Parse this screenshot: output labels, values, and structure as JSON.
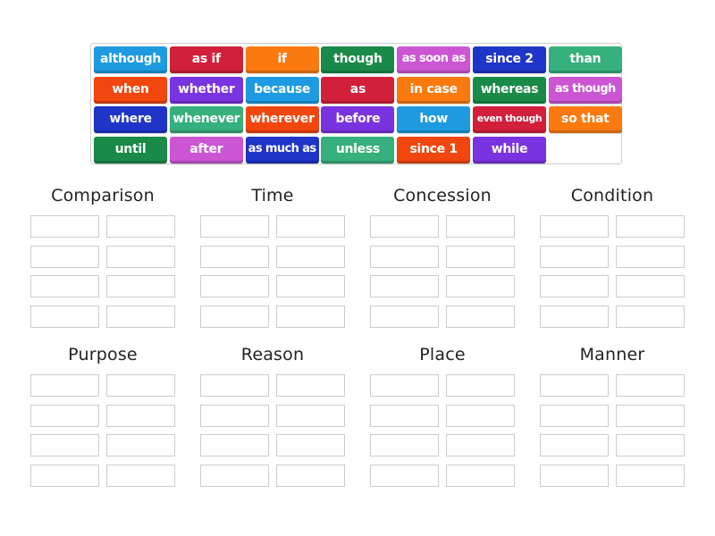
{
  "tile_bank": {
    "tiles": [
      {
        "label": "although",
        "color": "#1e9be0"
      },
      {
        "label": "as if",
        "color": "#d21f3a"
      },
      {
        "label": "if",
        "color": "#fb7a10"
      },
      {
        "label": "though",
        "color": "#198a48"
      },
      {
        "label": "as soon as",
        "color": "#cc55d4"
      },
      {
        "label": "since 2",
        "color": "#1f35c8"
      },
      {
        "label": "than",
        "color": "#36b07c"
      },
      {
        "label": "when",
        "color": "#f2460f"
      },
      {
        "label": "whether",
        "color": "#7a33e0"
      },
      {
        "label": "because",
        "color": "#1e9be0"
      },
      {
        "label": "as",
        "color": "#d21f3a"
      },
      {
        "label": "in case",
        "color": "#fb7a10"
      },
      {
        "label": "whereas",
        "color": "#198a48"
      },
      {
        "label": "as though",
        "color": "#cc55d4"
      },
      {
        "label": "where",
        "color": "#1f35c8"
      },
      {
        "label": "whenever",
        "color": "#36b07c"
      },
      {
        "label": "wherever",
        "color": "#f2460f"
      },
      {
        "label": "before",
        "color": "#7a33e0"
      },
      {
        "label": "how",
        "color": "#1e9be0"
      },
      {
        "label": "even though",
        "color": "#d21f3a"
      },
      {
        "label": "so that",
        "color": "#fb7a10"
      },
      {
        "label": "until",
        "color": "#198a48"
      },
      {
        "label": "after",
        "color": "#cc55d4"
      },
      {
        "label": "as much as",
        "color": "#1f35c8"
      },
      {
        "label": "unless",
        "color": "#36b07c"
      },
      {
        "label": "since 1",
        "color": "#f2460f"
      },
      {
        "label": "while",
        "color": "#7a33e0"
      }
    ]
  },
  "groups": [
    {
      "title": "Comparison",
      "slots": 8
    },
    {
      "title": "Time",
      "slots": 8
    },
    {
      "title": "Concession",
      "slots": 8
    },
    {
      "title": "Condition",
      "slots": 8
    },
    {
      "title": "Purpose",
      "slots": 8
    },
    {
      "title": "Reason",
      "slots": 8
    },
    {
      "title": "Place",
      "slots": 8
    },
    {
      "title": "Manner",
      "slots": 8
    }
  ]
}
